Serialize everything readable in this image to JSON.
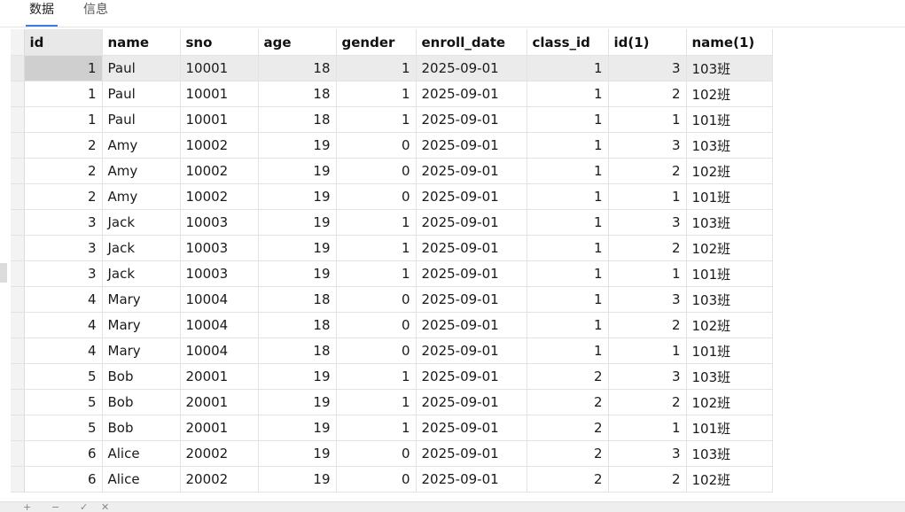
{
  "tabs": [
    {
      "label": "数据",
      "active": true
    },
    {
      "label": "信息",
      "active": false
    }
  ],
  "table": {
    "columns": [
      "id",
      "name",
      "sno",
      "age",
      "gender",
      "enroll_date",
      "class_id",
      "id(1)",
      "name(1)"
    ],
    "column_align": [
      "num",
      "txt",
      "txt",
      "num",
      "num",
      "txt",
      "num",
      "num",
      "txt"
    ],
    "rows": [
      [
        "1",
        "Paul",
        "10001",
        "18",
        "1",
        "2025-09-01",
        "1",
        "3",
        "103班"
      ],
      [
        "1",
        "Paul",
        "10001",
        "18",
        "1",
        "2025-09-01",
        "1",
        "2",
        "102班"
      ],
      [
        "1",
        "Paul",
        "10001",
        "18",
        "1",
        "2025-09-01",
        "1",
        "1",
        "101班"
      ],
      [
        "2",
        "Amy",
        "10002",
        "19",
        "0",
        "2025-09-01",
        "1",
        "3",
        "103班"
      ],
      [
        "2",
        "Amy",
        "10002",
        "19",
        "0",
        "2025-09-01",
        "1",
        "2",
        "102班"
      ],
      [
        "2",
        "Amy",
        "10002",
        "19",
        "0",
        "2025-09-01",
        "1",
        "1",
        "101班"
      ],
      [
        "3",
        "Jack",
        "10003",
        "19",
        "1",
        "2025-09-01",
        "1",
        "3",
        "103班"
      ],
      [
        "3",
        "Jack",
        "10003",
        "19",
        "1",
        "2025-09-01",
        "1",
        "2",
        "102班"
      ],
      [
        "3",
        "Jack",
        "10003",
        "19",
        "1",
        "2025-09-01",
        "1",
        "1",
        "101班"
      ],
      [
        "4",
        "Mary",
        "10004",
        "18",
        "0",
        "2025-09-01",
        "1",
        "3",
        "103班"
      ],
      [
        "4",
        "Mary",
        "10004",
        "18",
        "0",
        "2025-09-01",
        "1",
        "2",
        "102班"
      ],
      [
        "4",
        "Mary",
        "10004",
        "18",
        "0",
        "2025-09-01",
        "1",
        "1",
        "101班"
      ],
      [
        "5",
        "Bob",
        "20001",
        "19",
        "1",
        "2025-09-01",
        "2",
        "3",
        "103班"
      ],
      [
        "5",
        "Bob",
        "20001",
        "19",
        "1",
        "2025-09-01",
        "2",
        "2",
        "102班"
      ],
      [
        "5",
        "Bob",
        "20001",
        "19",
        "1",
        "2025-09-01",
        "2",
        "1",
        "101班"
      ],
      [
        "6",
        "Alice",
        "20002",
        "19",
        "0",
        "2025-09-01",
        "2",
        "3",
        "103班"
      ],
      [
        "6",
        "Alice",
        "20002",
        "19",
        "0",
        "2025-09-01",
        "2",
        "2",
        "102班"
      ]
    ],
    "selected_row": 0,
    "selected_column": 0
  },
  "bottombar": {
    "icons": [
      "plus-icon",
      "minus-icon",
      "check-icon",
      "close-icon"
    ]
  }
}
